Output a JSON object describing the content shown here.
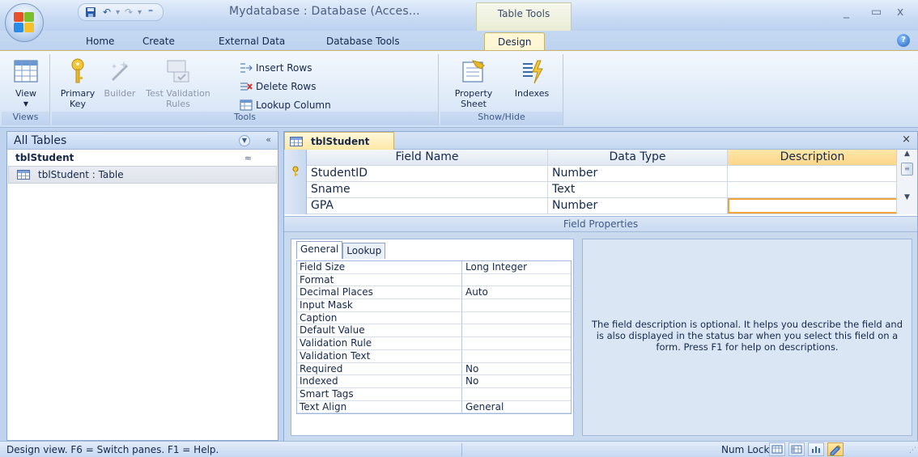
{
  "window": {
    "title": "Mydatabase : Database (Acces...",
    "context_title": "Table Tools",
    "minimize": "_",
    "maximize": "▭",
    "close": "x"
  },
  "qat": {
    "undo": "↶",
    "redo": "↷",
    "dropdown_sep": "▾",
    "customize": "⁼"
  },
  "tabs": [
    "Home",
    "Create",
    "External Data",
    "Database Tools",
    "Design"
  ],
  "active_tab": "Design",
  "ribbon": {
    "views": {
      "label": "Views",
      "view_label": "View"
    },
    "tools": {
      "label": "Tools",
      "primary_key": "Primary\nKey",
      "builder": "Builder",
      "test_validation": "Test Validation\nRules",
      "insert_rows": "Insert Rows",
      "delete_rows": "Delete Rows",
      "lookup_column": "Lookup Column"
    },
    "show_hide": {
      "label": "Show/Hide",
      "property_sheet": "Property\nSheet",
      "indexes": "Indexes"
    }
  },
  "nav": {
    "header": "All Tables",
    "collapse": "«",
    "group": "tblStudent",
    "group_chevron": "≈",
    "items": [
      {
        "label": "tblStudent : Table"
      }
    ]
  },
  "document": {
    "tab_label": "tblStudent",
    "close": "×",
    "columns": {
      "field_name": "Field Name",
      "data_type": "Data Type",
      "description": "Description"
    },
    "rows": [
      {
        "field_name": "StudentID",
        "data_type": "Number",
        "description": "",
        "primary_key": true
      },
      {
        "field_name": "Sname",
        "data_type": "Text",
        "description": ""
      },
      {
        "field_name": "GPA",
        "data_type": "Number",
        "description": ""
      }
    ],
    "primary_key_glyph": "🔑"
  },
  "field_properties": {
    "header": "Field Properties",
    "tabs": [
      "General",
      "Lookup"
    ],
    "active_tab": "General",
    "properties": [
      {
        "label": "Field Size",
        "value": "Long Integer"
      },
      {
        "label": "Format",
        "value": ""
      },
      {
        "label": "Decimal Places",
        "value": "Auto"
      },
      {
        "label": "Input Mask",
        "value": ""
      },
      {
        "label": "Caption",
        "value": ""
      },
      {
        "label": "Default Value",
        "value": ""
      },
      {
        "label": "Validation Rule",
        "value": ""
      },
      {
        "label": "Validation Text",
        "value": ""
      },
      {
        "label": "Required",
        "value": "No"
      },
      {
        "label": "Indexed",
        "value": "No"
      },
      {
        "label": "Smart Tags",
        "value": ""
      },
      {
        "label": "Text Align",
        "value": "General"
      }
    ],
    "help_text": "The field description is optional. It helps you describe the field and is also displayed in the status bar when you select this field on a form. Press F1 for help on descriptions."
  },
  "status": {
    "text": "Design view.  F6 = Switch panes.  F1 = Help.",
    "num_lock": "Num Lock"
  },
  "colors": {
    "ribbon_bg": "#dde9f8",
    "active_tab": "#fef6d4",
    "selection_border": "#f2a33a",
    "context_tab": "#e9ecd4"
  }
}
